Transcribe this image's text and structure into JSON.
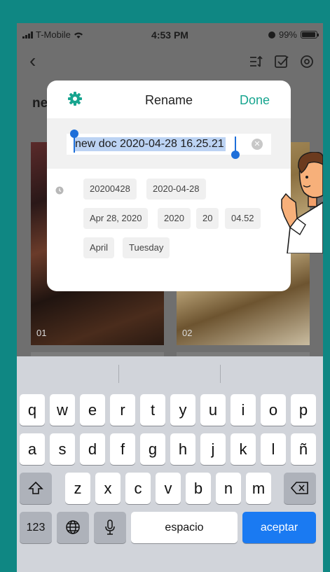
{
  "status_bar": {
    "carrier": "T-Mobile",
    "time": "4:53 PM",
    "battery": "99%"
  },
  "app_header": {
    "back_icon": "chevron-left-icon",
    "icons": [
      "sort-icon",
      "select-checkbox-icon",
      "settings-gear-icon"
    ]
  },
  "document": {
    "title_partial": "ne",
    "thumbnails": [
      {
        "number": "01"
      },
      {
        "number": "02"
      }
    ]
  },
  "rename_dialog": {
    "title": "Rename",
    "done_label": "Done",
    "input_value": "new doc 2020-04-28 16.25.21",
    "suggestions": [
      "20200428",
      "2020-04-28",
      "Apr 28, 2020",
      "2020",
      "20",
      "04.52",
      "April",
      "Tuesday"
    ]
  },
  "keyboard": {
    "row1": [
      "q",
      "w",
      "e",
      "r",
      "t",
      "y",
      "u",
      "i",
      "o",
      "p"
    ],
    "row2": [
      "a",
      "s",
      "d",
      "f",
      "g",
      "h",
      "j",
      "k",
      "l",
      "ñ"
    ],
    "row3": [
      "z",
      "x",
      "c",
      "v",
      "b",
      "n",
      "m"
    ],
    "numbers_label": "123",
    "space_label": "espacio",
    "return_label": "aceptar"
  },
  "colors": {
    "background": "#0f8783",
    "accent": "#17a58f",
    "selection": "#bcd3f3",
    "return_key": "#1a7af2"
  }
}
